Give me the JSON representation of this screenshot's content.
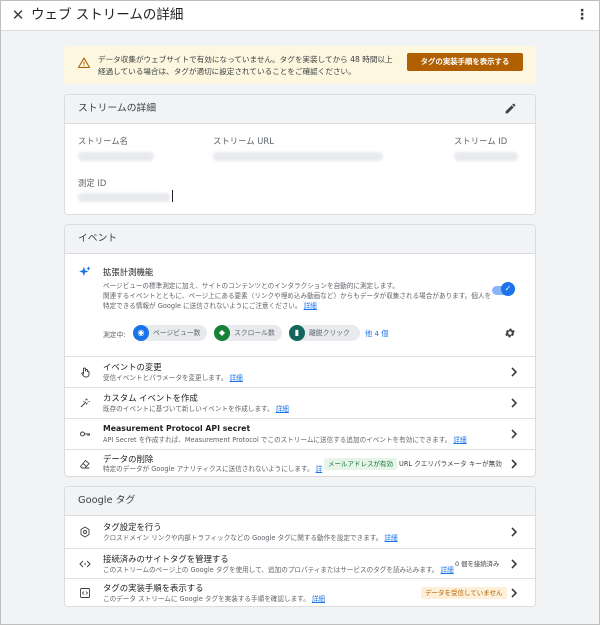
{
  "header": {
    "title": "ウェブ ストリームの詳細",
    "close_icon": "close-icon",
    "menu_icon": "more-vert-icon"
  },
  "banner": {
    "line1": "データ収集がウェブサイトで有効になっていません。タグを実装してから 48 時間以上",
    "line2": "経過している場合は、タグが適切に設定されていることをご確認ください。",
    "button": "タグの実装手順を表示する",
    "icon": "warning-icon"
  },
  "stream_details": {
    "title": "ストリームの詳細",
    "stream_name_label": "ストリーム名",
    "stream_url_label": "ストリーム URL",
    "stream_id_label": "ストリーム ID",
    "measurement_id_label": "測定 ID"
  },
  "events": {
    "title": "イベント",
    "enhanced": {
      "title": "拡張計測機能",
      "desc1": "ページビューの標準測定に加え、サイトのコンテンツとのインタラクションを自動的に測定します。",
      "desc2": "関連するイベントとともに、ページ上にある要素（リンクや埋め込み動画など）からもデータが収集される場合があります。個人を",
      "desc3": "特定できる情報が Google に送信されないようにご注意ください。",
      "more": "詳細",
      "measuring_label": "測定中:",
      "chips": [
        "ページビュー数",
        "スクロール数",
        "離脱クリック"
      ],
      "others": "他 4 個",
      "toggle_on": true
    },
    "rows": [
      {
        "title": "イベントの変更",
        "desc": "受信イベントとパラメータを変更します。",
        "link": "詳細"
      },
      {
        "title": "カスタム イベントを作成",
        "desc": "既存のイベントに基づいて新しいイベントを作成します。",
        "link": "詳細"
      },
      {
        "title": "Measurement Protocol API secret",
        "desc": "API Secret を作成すれば、Measurement Protocol でこのストリームに送信する追加のイベントを有効にできます。",
        "link": "詳細"
      },
      {
        "title": "データの削除",
        "desc": "特定のデータが Google アナリティクスに送信されないようにします。",
        "link": "詳",
        "badge": "メールアドレスが有効",
        "extra": "URL クエリパラメータ キーが無効"
      }
    ]
  },
  "google_tag": {
    "title": "Google タグ",
    "rows": [
      {
        "title": "タグ設定を行う",
        "desc": "クロスドメイン リンクや内部トラフィックなどの Google タグに関する動作を設定できます。",
        "link": "詳細"
      },
      {
        "title": "接続済みのサイトタグを管理する",
        "desc": "このストリームのページ上の Google タグを使用して、追加のプロパティまたはサービスのタグを読み込みます。",
        "link": "詳細",
        "extra": "0 個を接続済み"
      },
      {
        "title": "タグの実装手順を表示する",
        "desc": "このデータ ストリームに Google タグを実装する手順を確認します。",
        "link": "詳細",
        "badge": "データを受信していません"
      }
    ]
  }
}
